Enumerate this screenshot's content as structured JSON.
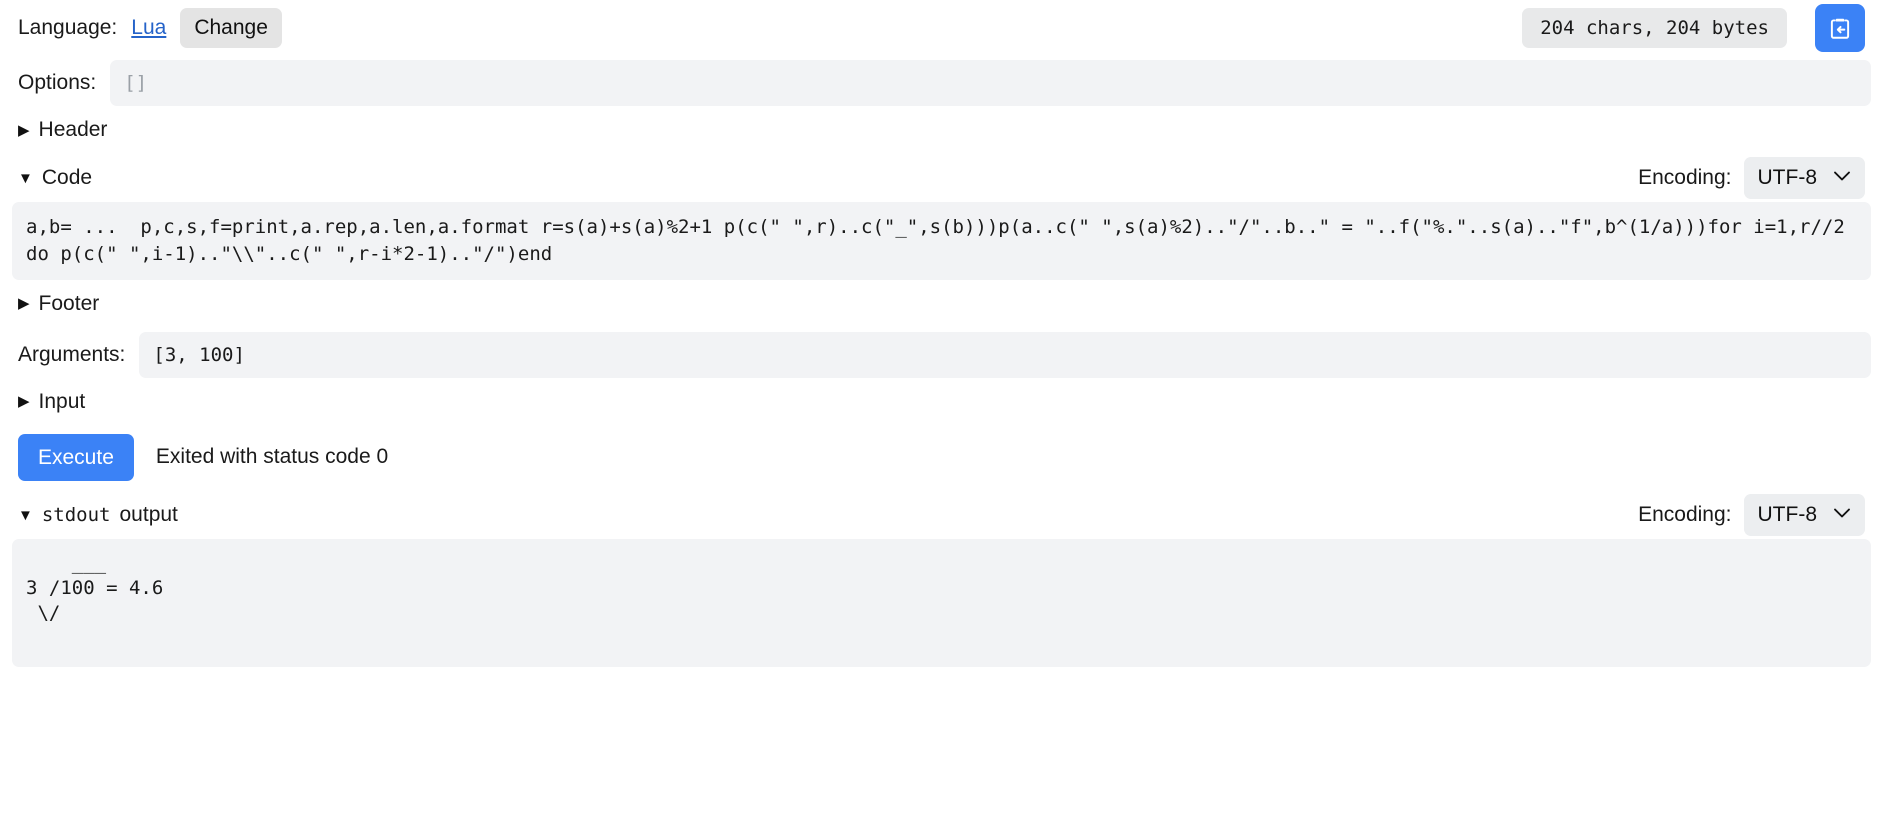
{
  "topbar": {
    "language_label": "Language:",
    "language_value": "Lua",
    "change_label": "Change",
    "size_badge": "204 chars, 204 bytes",
    "copy_icon": "clipboard-import-icon",
    "accent_color": "#3b82f6"
  },
  "options": {
    "label": "Options:",
    "value": "",
    "placeholder": "[]"
  },
  "sections": {
    "header": {
      "label": "Header",
      "marker": "▶",
      "expanded": false
    },
    "code": {
      "label": "Code",
      "marker": "▼",
      "expanded": true
    },
    "footer": {
      "label": "Footer",
      "marker": "▶",
      "expanded": false
    },
    "input": {
      "label": "Input",
      "marker": "▶",
      "expanded": false
    },
    "stdout": {
      "label_mono": "stdout",
      "label_rest": " output",
      "marker": "▼",
      "expanded": true
    }
  },
  "encoding": {
    "label": "Encoding:",
    "value": "UTF-8",
    "chevron": "chevron-down-icon"
  },
  "code": {
    "text": "a,b= ...  p,c,s,f=print,a.rep,a.len,a.format r=s(a)+s(a)%2+1 p(c(\" \",r)..c(\"_\",s(b)))p(a..c(\" \",s(a)%2)..\"/\"..b..\" = \"..f(\"%.\"..s(a)..\"f\",b^(1/a)))for i=1,r//2 do p(c(\" \",i-1)..\"\\\\\"..c(\" \",r-i*2-1)..\"/\")end"
  },
  "arguments": {
    "label": "Arguments:",
    "value": "[3, 100]"
  },
  "execute": {
    "button_label": "Execute",
    "status_text": "Exited with status code 0"
  },
  "stdout_output": {
    "text": "    ___\n3 /100 = 4.6\n \\/"
  }
}
